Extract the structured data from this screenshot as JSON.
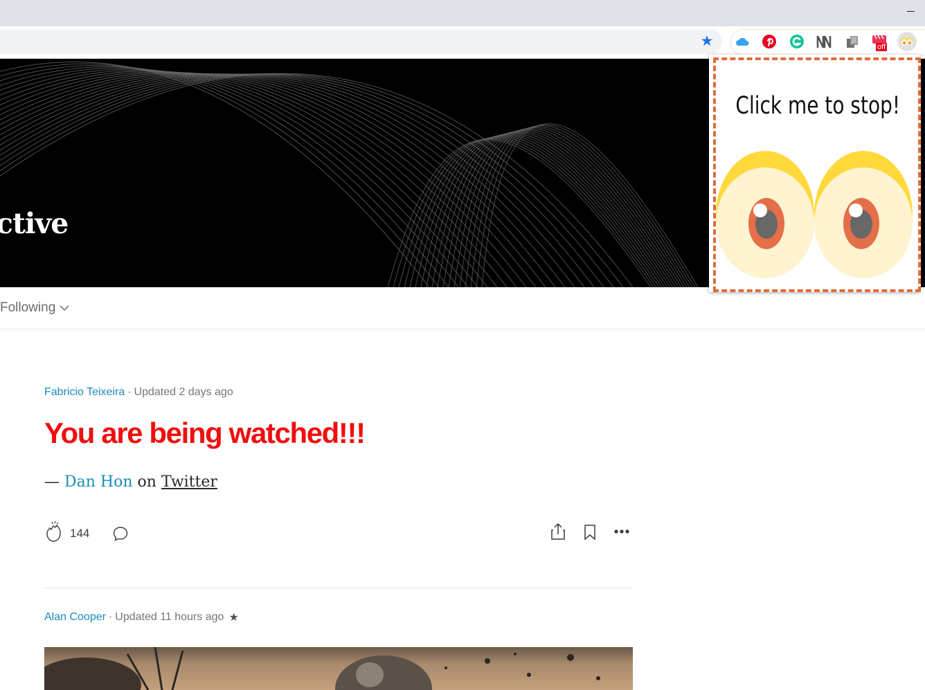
{
  "browser": {
    "extensions": [
      "icloud-icon",
      "pinterest-icon",
      "grammarly-icon",
      "notion-icon",
      "copy-icon",
      "video-off-icon",
      "eyes-extension-icon"
    ],
    "badge_off": "off"
  },
  "hero": {
    "text": "ctive"
  },
  "nav": {
    "following_label": "Following"
  },
  "posts": [
    {
      "author": "Fabricio Teixeira",
      "separator": "·",
      "updated": "Updated 2 days ago",
      "title": "You are being watched!!!",
      "quote": {
        "dash": "—",
        "name": "Dan Hon",
        "on": "on",
        "source": "Twitter"
      },
      "claps": "144"
    },
    {
      "author": "Alan Cooper",
      "separator": "·",
      "updated": "Updated 11 hours ago",
      "star": "★"
    }
  ],
  "popup": {
    "title": "Click me to stop!"
  },
  "colors": {
    "title_red": "#f00f0f",
    "author_blue": "#1a8bba",
    "popup_border": "#e06c3c",
    "eye_lid": "#ffd93b",
    "iris": "#e46f49"
  }
}
